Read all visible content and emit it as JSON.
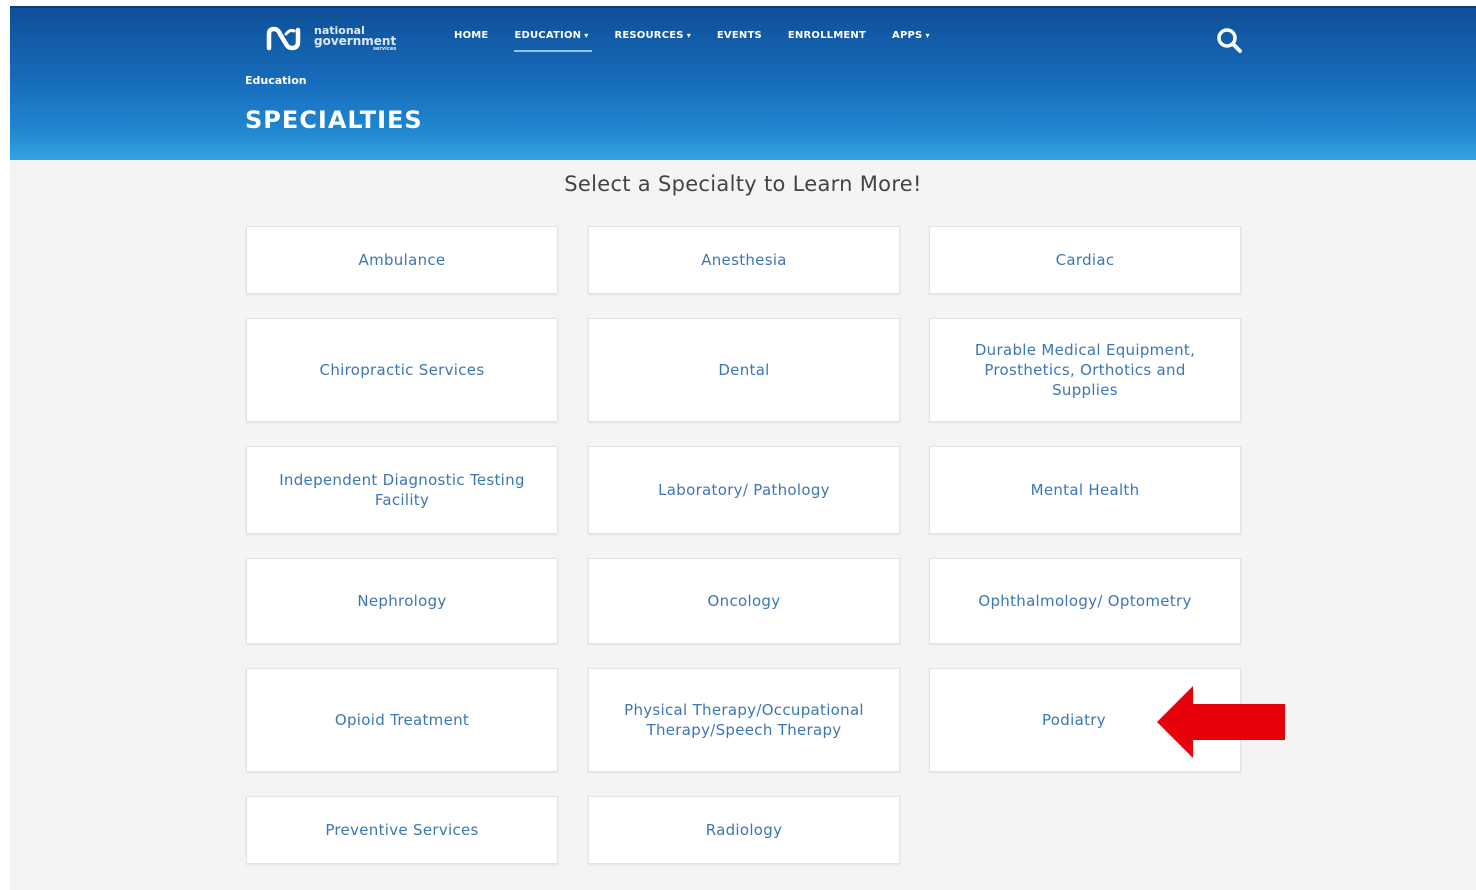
{
  "brand": {
    "line1": "national",
    "line2": "government",
    "line3": "services",
    "color": "#1669b8"
  },
  "nav": [
    {
      "label": "HOME",
      "caret": "",
      "active": false
    },
    {
      "label": "EDUCATION",
      "caret": "▾",
      "active": true
    },
    {
      "label": "RESOURCES",
      "caret": "▾",
      "active": false
    },
    {
      "label": "EVENTS",
      "caret": "",
      "active": false
    },
    {
      "label": "ENROLLMENT",
      "caret": "",
      "active": false
    },
    {
      "label": "APPS",
      "caret": "▾",
      "active": false
    }
  ],
  "search_icon": "search-icon",
  "breadcrumb": "Education",
  "page_title": "SPECIALTIES",
  "subtitle": "Select a Specialty to Learn More!",
  "specialties": [
    "Ambulance",
    "Anesthesia",
    "Cardiac",
    "Chiropractic Services",
    "Dental",
    "Durable Medical Equipment, Prosthetics, Orthotics and Supplies",
    "Independent Diagnostic Testing Facility",
    "Laboratory/ Pathology",
    "Mental Health",
    "Nephrology",
    "Oncology",
    "Ophthalmology/ Optometry",
    "Opioid Treatment",
    "Physical Therapy/Occupational Therapy/Speech Therapy",
    "Podiatry",
    "Preventive Services",
    "Radiology"
  ],
  "highlight": {
    "target": "Podiatry",
    "color": "#e8000b",
    "icon": "arrow-left-icon"
  }
}
